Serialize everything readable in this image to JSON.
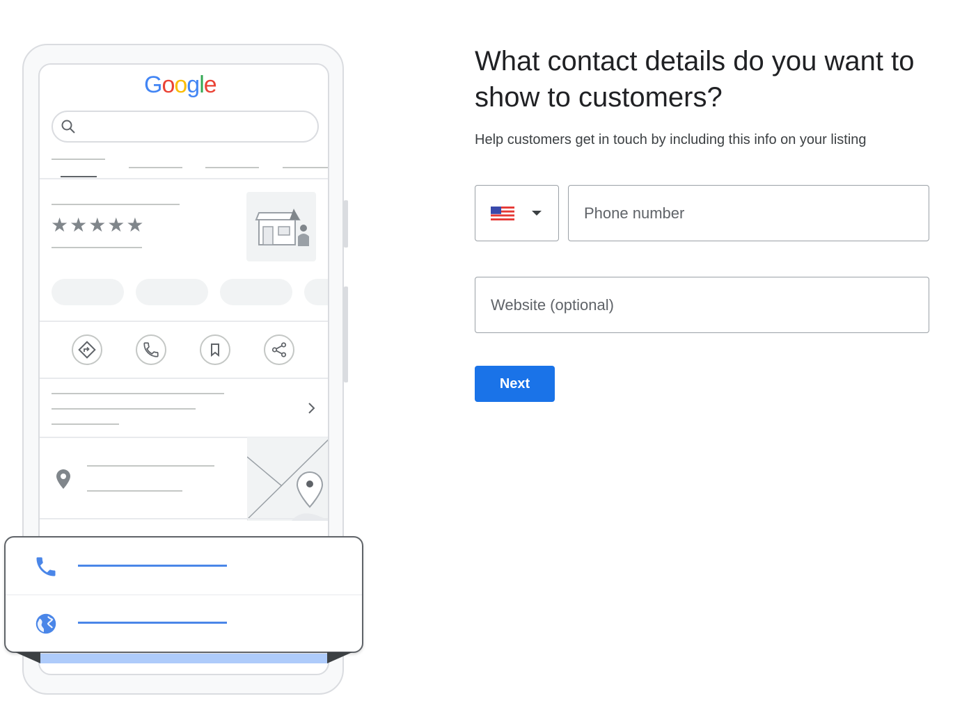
{
  "form": {
    "heading": "What contact details do you want to show to customers?",
    "subtext": "Help customers get in touch by including this info on your listing",
    "country": {
      "flag": "us-flag-icon",
      "code": "US"
    },
    "phone_placeholder": "Phone number",
    "phone_value": "",
    "website_placeholder": "Website (optional)",
    "website_value": "",
    "next_label": "Next",
    "accent_color": "#1a73e8"
  },
  "illustration": {
    "logo": [
      "G",
      "o",
      "o",
      "g",
      "l",
      "e"
    ],
    "logo_colors": [
      "#4285F4",
      "#EA4335",
      "#FBBC05",
      "#4285F4",
      "#34A853",
      "#EA4335"
    ],
    "rating_stars": "★★★★★",
    "action_icons": [
      "directions-icon",
      "phone-icon",
      "bookmark-icon",
      "share-icon"
    ],
    "popup_items": [
      "phone-icon",
      "globe-icon"
    ]
  }
}
